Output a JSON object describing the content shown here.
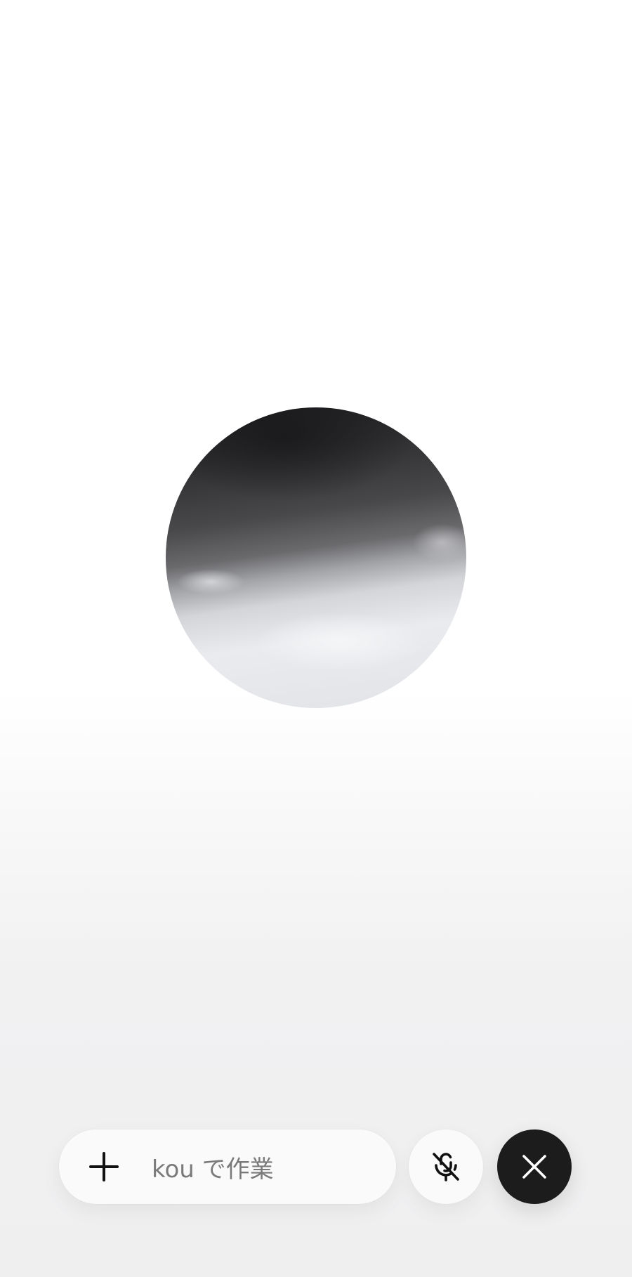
{
  "composer": {
    "placeholder": "kou で作業",
    "add_icon": "plus-icon"
  },
  "controls": {
    "mic_icon": "mic-off-icon",
    "close_icon": "close-icon"
  },
  "colors": {
    "close_button_bg": "#1c1c1c",
    "pill_bg": "#fafafa",
    "placeholder_text": "#7a7a7a"
  }
}
